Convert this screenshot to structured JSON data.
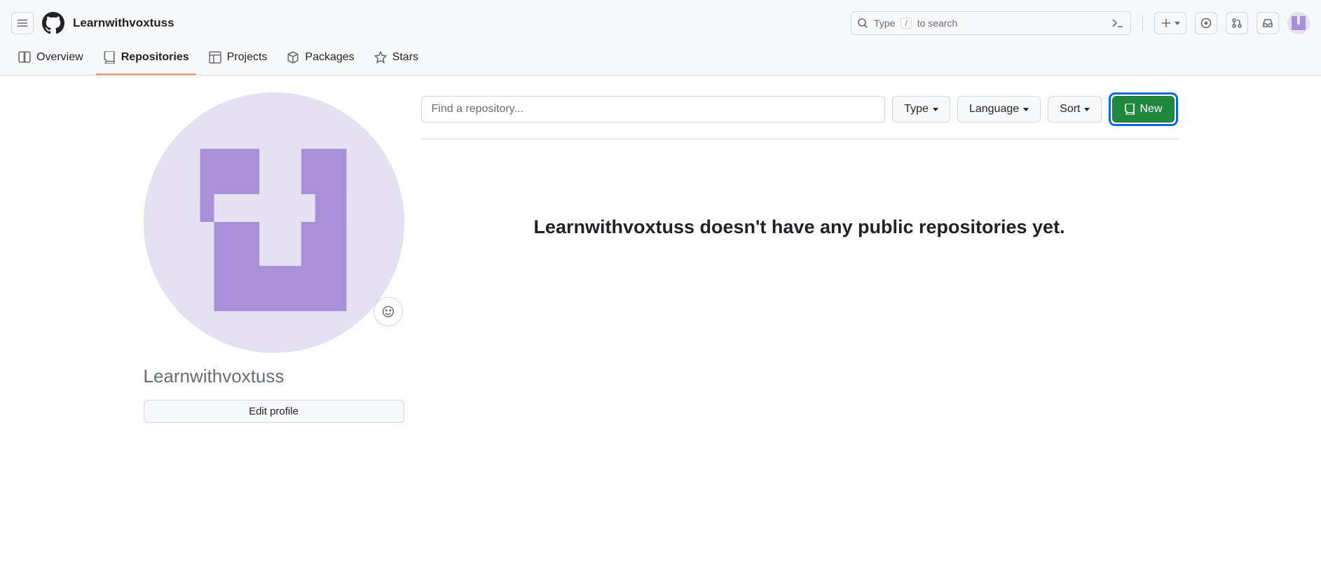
{
  "header": {
    "username": "Learnwithvoxtuss",
    "search_prefix": "Type",
    "search_key": "/",
    "search_suffix": "to search"
  },
  "tabs": {
    "overview": "Overview",
    "repositories": "Repositories",
    "projects": "Projects",
    "packages": "Packages",
    "stars": "Stars"
  },
  "profile": {
    "name": "Learnwithvoxtuss",
    "edit_button": "Edit profile"
  },
  "filters": {
    "search_placeholder": "Find a repository...",
    "type": "Type",
    "language": "Language",
    "sort": "Sort",
    "new": "New"
  },
  "empty_message": "Learnwithvoxtuss doesn't have any public repositories yet.",
  "colors": {
    "avatar_purple": "#a98ed8",
    "avatar_bg": "#e5e1f3",
    "accent_green": "#1f883d",
    "focus_blue": "#0969da"
  }
}
